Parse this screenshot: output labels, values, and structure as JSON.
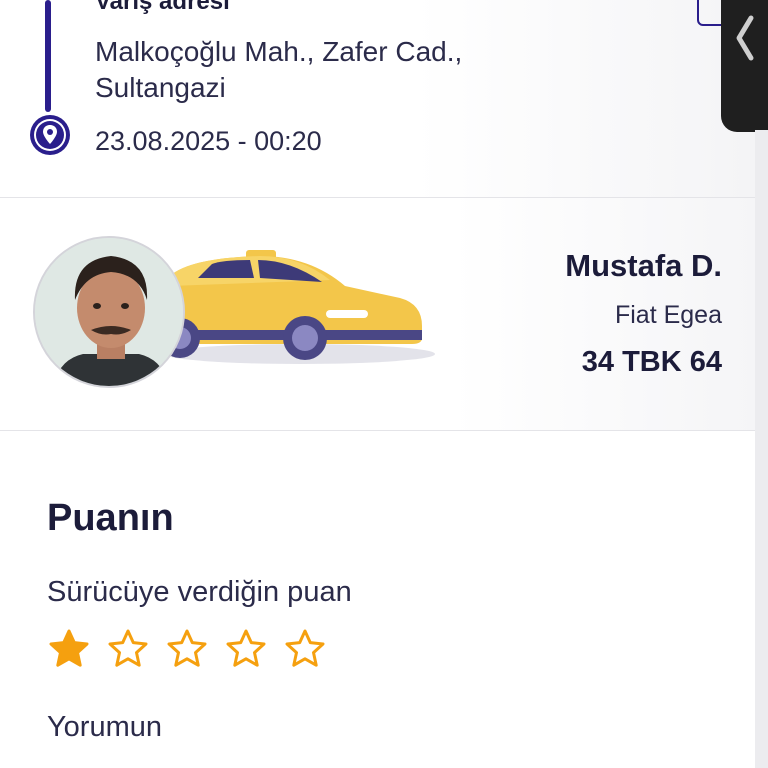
{
  "trip": {
    "arrival_label": "Varış adresi",
    "address": "Malkoçoğlu Mah., Zafer Cad., Sultangazi",
    "datetime": "23.08.2025 - 00:20"
  },
  "driver": {
    "name": "Mustafa D.",
    "car_model": "Fiat Egea",
    "plate": "34 TBK 64"
  },
  "rating": {
    "title": "Puanın",
    "label": "Sürücüye verdiğin puan",
    "stars_total": 5,
    "stars_given": 1,
    "comment_label": "Yorumun"
  },
  "colors": {
    "accent": "#2a1e8c",
    "star": "#f5a00f",
    "taxi": "#f3c64a"
  },
  "icons": {
    "location": "location-pin-icon",
    "back": "chevron-left-icon",
    "star": "star-icon"
  }
}
